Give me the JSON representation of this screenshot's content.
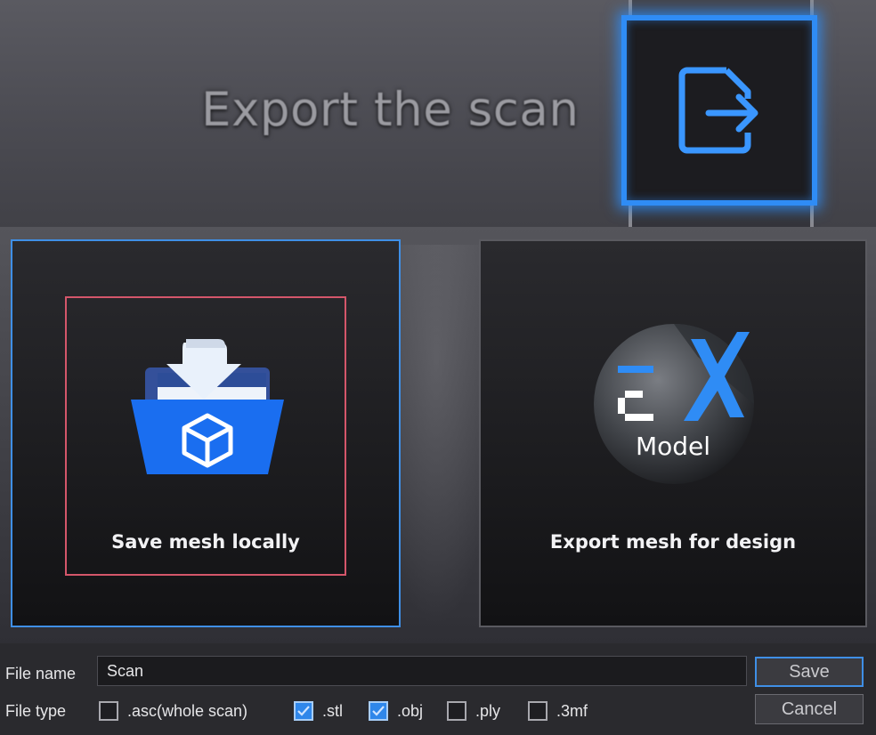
{
  "banner": {
    "title": "Export the scan",
    "export_icon": "export-arrow-icon"
  },
  "options": [
    {
      "label": "Save mesh locally",
      "icon": "save-folder-cube-icon",
      "selected": true
    },
    {
      "label": "Export mesh for design",
      "icon": "exmodel-logo",
      "logo_text": "Model",
      "selected": false
    }
  ],
  "form": {
    "file_name_label": "File name",
    "file_name_value": "Scan",
    "file_type_label": "File type",
    "file_types": [
      {
        "label": ".asc(whole scan)",
        "checked": false
      },
      {
        "label": ".stl",
        "checked": true
      },
      {
        "label": ".obj",
        "checked": true
      },
      {
        "label": ".ply",
        "checked": false
      },
      {
        "label": ".3mf",
        "checked": false
      }
    ],
    "save_label": "Save",
    "cancel_label": "Cancel"
  },
  "colors": {
    "accent": "#2f8cf5",
    "highlight": "#d4566a",
    "background": "#2a2a2e"
  }
}
